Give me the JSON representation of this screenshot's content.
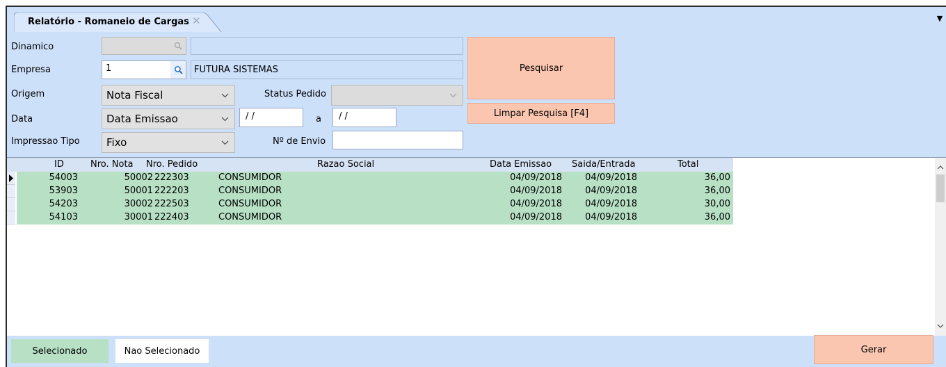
{
  "tab": {
    "title": "Relatório - Romaneio de Cargas"
  },
  "form": {
    "dinamico": {
      "label": "Dinamico",
      "code": "",
      "desc": ""
    },
    "empresa": {
      "label": "Empresa",
      "code": "1",
      "desc": "FUTURA SISTEMAS"
    },
    "origem": {
      "label": "Origem",
      "value": "Nota Fiscal"
    },
    "status_pedido": {
      "label": "Status Pedido",
      "value": ""
    },
    "data": {
      "label": "Data",
      "type": "Data Emissao",
      "from": "/ /",
      "sep": "a",
      "to": "/ /"
    },
    "impressao_tipo": {
      "label": "Impressao Tipo",
      "value": "Fixo"
    },
    "envio": {
      "label": "Nº de Envio",
      "value": ""
    }
  },
  "buttons": {
    "pesquisar": "Pesquisar",
    "limpar": "Limpar Pesquisa [F4]",
    "gerar": "Gerar"
  },
  "grid": {
    "headers": [
      "ID",
      "Nro. Nota",
      "Nro. Pedido",
      "Razao Social",
      "Data Emissao",
      "Saida/Entrada",
      "Total"
    ],
    "rows": [
      {
        "id": "54003",
        "nota": "50002",
        "pedido": "222303",
        "razao": "CONSUMIDOR",
        "emissao": "04/09/2018",
        "saida": "04/09/2018",
        "total": "36,00"
      },
      {
        "id": "53903",
        "nota": "50001",
        "pedido": "222203",
        "razao": "CONSUMIDOR",
        "emissao": "04/09/2018",
        "saida": "04/09/2018",
        "total": "36,00"
      },
      {
        "id": "54203",
        "nota": "30002",
        "pedido": "222503",
        "razao": "CONSUMIDOR",
        "emissao": "04/09/2018",
        "saida": "04/09/2018",
        "total": "30,00"
      },
      {
        "id": "54103",
        "nota": "30001",
        "pedido": "222403",
        "razao": "CONSUMIDOR",
        "emissao": "04/09/2018",
        "saida": "04/09/2018",
        "total": "36,00"
      }
    ]
  },
  "legend": {
    "selected": "Selecionado",
    "not_selected": "Nao Selecionado"
  },
  "colors": {
    "selected_row": "#b7e0c5",
    "button": "#fbc6b0",
    "background": "#cde0fa"
  }
}
